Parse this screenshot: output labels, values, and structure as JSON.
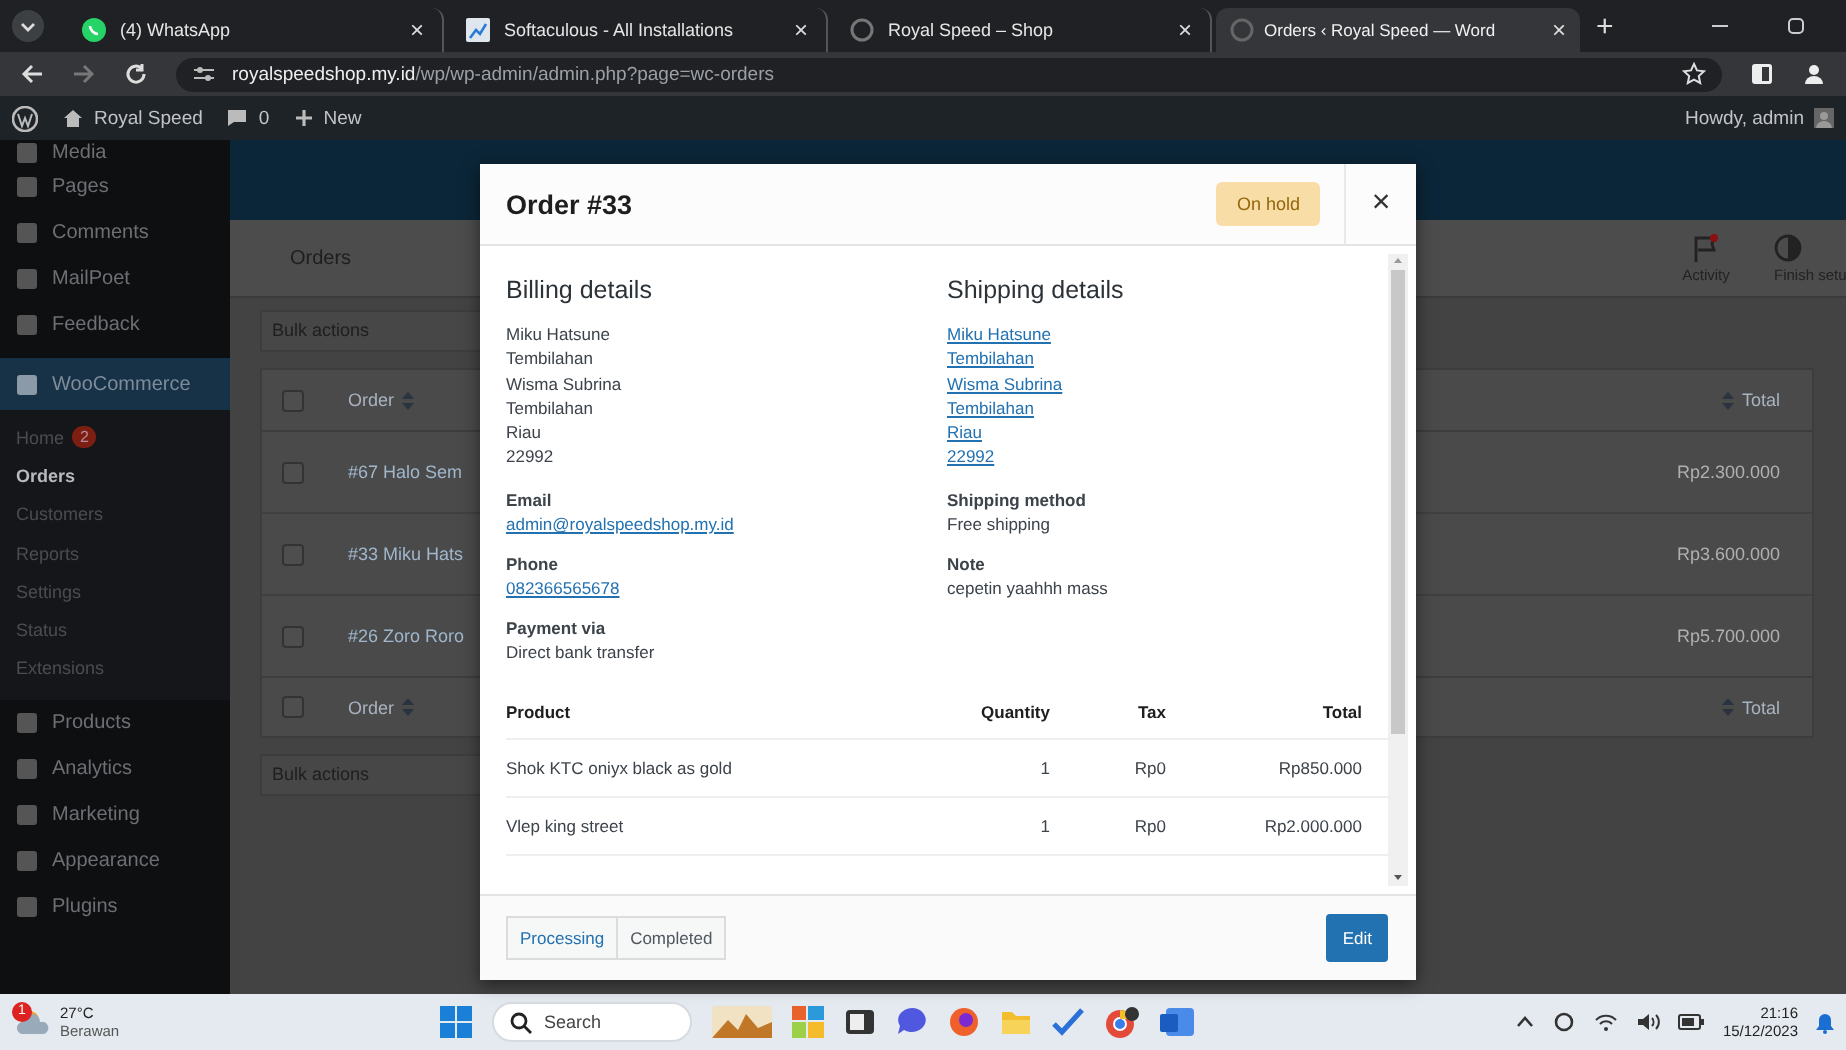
{
  "browser": {
    "tabs": [
      {
        "title": "(4) WhatsApp",
        "close": "×",
        "selected": false
      },
      {
        "title": "Softaculous - All Installations",
        "close": "×",
        "selected": false
      },
      {
        "title": "Royal Speed – Shop",
        "close": "×",
        "selected": false
      },
      {
        "title": "Orders ‹ Royal Speed — Word",
        "close": "×",
        "selected": true
      }
    ],
    "new_tab": "+",
    "url": "**royalspeedshop.my.id**/wp/wp-admin/admin.php?page=wc-orders"
  },
  "admin_bar": {
    "site": "Royal Speed",
    "comments": "0",
    "new": "New",
    "greeting": "Howdy, admin"
  },
  "sidebar": {
    "items": [
      {
        "label": "Media",
        "selected": false
      },
      {
        "label": "Pages",
        "selected": false
      },
      {
        "label": "Comments",
        "selected": false
      },
      {
        "label": "MailPoet",
        "selected": false
      },
      {
        "label": "Feedback",
        "selected": false
      },
      {
        "label": "WooCommerce",
        "selected": true,
        "children": [
          {
            "label": "Home",
            "badge": "2",
            "selected": false
          },
          {
            "label": "Orders",
            "selected": true
          },
          {
            "label": "Customers",
            "selected": false
          },
          {
            "label": "Reports",
            "selected": false
          },
          {
            "label": "Settings",
            "selected": false
          },
          {
            "label": "Status",
            "selected": false
          },
          {
            "label": "Extensions",
            "selected": false
          }
        ]
      },
      {
        "label": "Products",
        "selected": false
      },
      {
        "label": "Analytics",
        "selected": false
      },
      {
        "label": "Marketing",
        "selected": false
      },
      {
        "label": "Appearance",
        "selected": false
      },
      {
        "label": "Plugins",
        "selected": false
      }
    ]
  },
  "page": {
    "title": "Orders",
    "toolbar": [
      {
        "label": "Activity"
      },
      {
        "label": "Finish setu"
      }
    ],
    "bulk_actions_top": "Bulk actions",
    "bulk_actions_bottom": "Bulk actions",
    "table": {
      "header": {
        "order": "Order",
        "total": "Total",
        "checked": false
      },
      "rows": [
        {
          "order": "#67 Halo Sem",
          "total": "Rp2.300.000",
          "checked": false
        },
        {
          "order": "#33 Miku Hats",
          "total": "Rp3.600.000",
          "checked": false
        },
        {
          "order": "#26 Zoro Roro",
          "total": "Rp5.700.000",
          "checked": false
        }
      ],
      "footer": {
        "order": "Order",
        "total": "Total",
        "checked": false
      }
    }
  },
  "modal": {
    "title": "Order #33",
    "status": "On hold",
    "close": "×",
    "billing": {
      "heading": "Billing details",
      "address": [
        "Miku Hatsune",
        "Tembilahan",
        "Wisma Subrina",
        "Tembilahan",
        "Riau",
        "22992"
      ],
      "fields": [
        {
          "label": "Email",
          "value": "admin@royalspeedshop.my.id",
          "kind": "link"
        },
        {
          "label": "Phone",
          "value": "082366565678",
          "kind": "link"
        },
        {
          "label": "Payment via",
          "value": "Direct bank transfer",
          "kind": "text"
        }
      ]
    },
    "shipping": {
      "heading": "Shipping details",
      "address": [
        "Miku Hatsune",
        "Tembilahan",
        "Wisma Subrina",
        "Tembilahan",
        "Riau",
        "22992"
      ],
      "fields": [
        {
          "label": "Shipping method",
          "value": "Free shipping",
          "kind": "text"
        },
        {
          "label": "Note",
          "value": "cepetin yaahhh mass",
          "kind": "text"
        }
      ]
    },
    "items": {
      "columns": [
        "Product",
        "Quantity",
        "Tax",
        "Total"
      ],
      "rows": [
        [
          "Shok KTC oniyx black as gold",
          "1",
          "Rp0",
          "Rp850.000"
        ],
        [
          "Vlep king street",
          "1",
          "Rp0",
          "Rp2.000.000"
        ]
      ]
    },
    "status_buttons": [
      "Processing",
      "Completed"
    ],
    "edit": "Edit"
  },
  "taskbar": {
    "temperature": "27°C",
    "weather": "Berawan",
    "weather_badge": "1",
    "search": "Search",
    "time": "21:16",
    "date": "15/12/2023"
  }
}
